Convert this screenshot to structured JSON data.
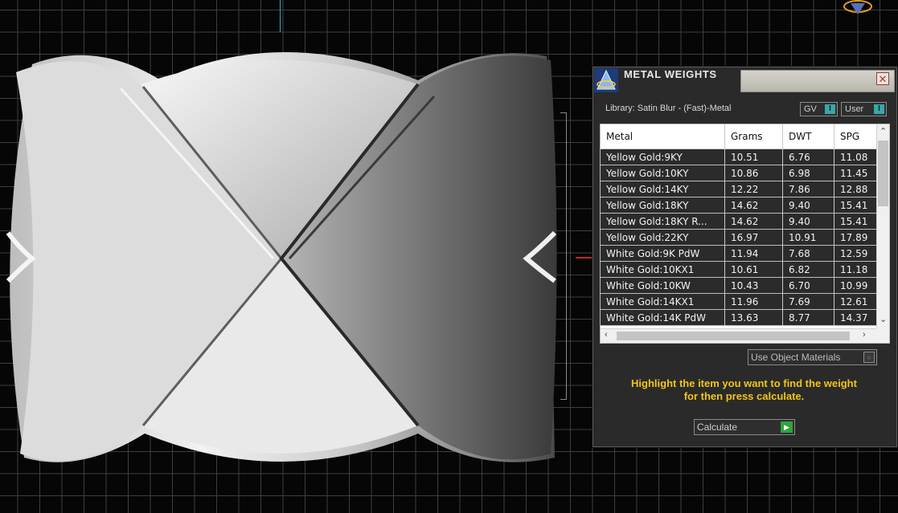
{
  "dialog": {
    "title": "METAL WEIGHTS",
    "close_glyph": "✕",
    "library_label": "Library: Satin Blur - (Fast)-Metal",
    "gv_label": "GV",
    "user_label": "User",
    "toggle_glyph": "I",
    "use_object_materials_label": "Use Object Materials",
    "hint_line1": "Highlight the item you want to find the weight",
    "hint_line2": "for then press calculate.",
    "calculate_label": "Calculate"
  },
  "table": {
    "headers": [
      "Metal",
      "Grams",
      "DWT",
      "SPG"
    ],
    "rows": [
      [
        "Yellow Gold:9KY",
        "10.51",
        "6.76",
        "11.08"
      ],
      [
        "Yellow Gold:10KY",
        "10.86",
        "6.98",
        "11.45"
      ],
      [
        "Yellow Gold:14KY",
        "12.22",
        "7.86",
        "12.88"
      ],
      [
        "Yellow Gold:18KY",
        "14.62",
        "9.40",
        "15.41"
      ],
      [
        "Yellow Gold:18KY R...",
        "14.62",
        "9.40",
        "15.41"
      ],
      [
        "Yellow Gold:22KY",
        "16.97",
        "10.91",
        "17.89"
      ],
      [
        "White Gold:9K PdW",
        "11.94",
        "7.68",
        "12.59"
      ],
      [
        "White Gold:10KX1",
        "10.61",
        "6.82",
        "11.18"
      ],
      [
        "White Gold:10KW",
        "10.43",
        "6.70",
        "10.99"
      ],
      [
        "White Gold:14KX1",
        "11.96",
        "7.69",
        "12.61"
      ],
      [
        "White Gold:14K PdW",
        "13.63",
        "8.77",
        "14.37"
      ]
    ]
  },
  "colors": {
    "hint": "#f0c419",
    "toggle_accent": "#3aa7a8",
    "calculate_accent": "#2fa53a"
  },
  "icons": [
    "app-logo-icon",
    "close-icon",
    "calculate-arrow-icon",
    "scroll-up-icon",
    "scroll-down-icon",
    "scroll-left-icon",
    "scroll-right-icon"
  ]
}
